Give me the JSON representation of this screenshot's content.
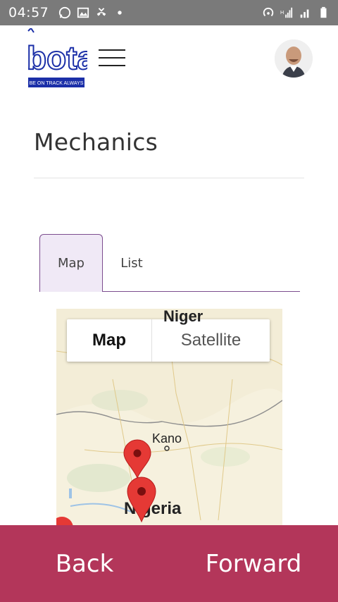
{
  "statusbar": {
    "time": "04:57",
    "icons_left": [
      "whatsapp-icon",
      "gallery-icon",
      "missed-call-icon",
      "dot-icon"
    ],
    "icons_right": [
      "hotspot-icon",
      "signal-icon",
      "data-signal-icon",
      "battery-icon"
    ],
    "network_label": "H"
  },
  "header": {
    "logo_text": "bota",
    "logo_tagline": "BE ON TRACK ALWAYS",
    "menu_icon": "hamburger-icon",
    "avatar": "user-avatar"
  },
  "page": {
    "title": "Mechanics"
  },
  "tabs": [
    {
      "label": "Map",
      "active": true
    },
    {
      "label": "List",
      "active": false
    }
  ],
  "map": {
    "type_control": {
      "map_label": "Map",
      "satellite_label": "Satellite",
      "selected": "Map"
    },
    "labels": {
      "niger": "Niger",
      "kano": "Kano",
      "nigeria": "Nigeria"
    },
    "markers": [
      "marker-pin-icon",
      "marker-pin-icon",
      "marker-pin-icon"
    ]
  },
  "footer": {
    "back_label": "Back",
    "forward_label": "Forward"
  },
  "colors": {
    "statusbar": "#7a7a7a",
    "accent": "#7c4d8f",
    "tab_active_bg": "#f0e9f6",
    "footer_bg": "#b3365a",
    "logo_blue": "#1b2fa8",
    "marker_red": "#e53935"
  }
}
